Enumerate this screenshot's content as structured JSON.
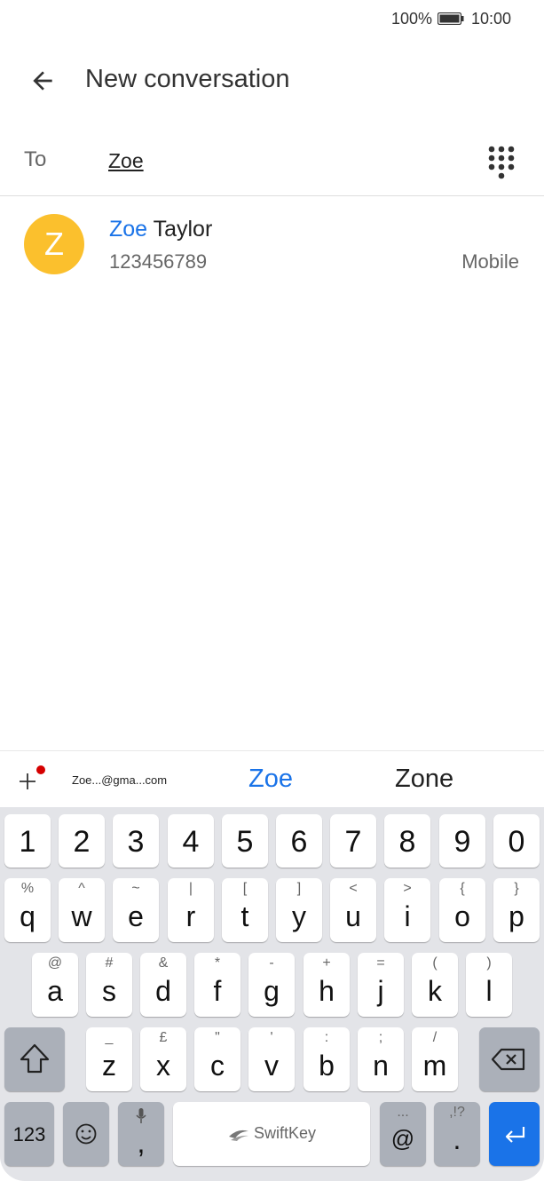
{
  "status_bar": {
    "battery": "100%",
    "time": "10:00"
  },
  "app_bar": {
    "title": "New conversation"
  },
  "recipient": {
    "label": "To",
    "value": "Zoe"
  },
  "contact": {
    "avatar_letter": "Z",
    "avatar_color": "#fbc02d",
    "name_match": "Zoe",
    "name_rest": " Taylor",
    "number": "123456789",
    "type": "Mobile"
  },
  "suggestions": {
    "email": "Zoe...@gma...com",
    "items": [
      "Zoe",
      "Zone"
    ]
  },
  "keyboard": {
    "number_row": [
      "1",
      "2",
      "3",
      "4",
      "5",
      "6",
      "7",
      "8",
      "9",
      "0"
    ],
    "row1": [
      {
        "main": "q",
        "sub": "%"
      },
      {
        "main": "w",
        "sub": "^"
      },
      {
        "main": "e",
        "sub": "~"
      },
      {
        "main": "r",
        "sub": "|"
      },
      {
        "main": "t",
        "sub": "["
      },
      {
        "main": "y",
        "sub": "]"
      },
      {
        "main": "u",
        "sub": "<"
      },
      {
        "main": "i",
        "sub": ">"
      },
      {
        "main": "o",
        "sub": "{"
      },
      {
        "main": "p",
        "sub": "}"
      }
    ],
    "row2": [
      {
        "main": "a",
        "sub": "@"
      },
      {
        "main": "s",
        "sub": "#"
      },
      {
        "main": "d",
        "sub": "&"
      },
      {
        "main": "f",
        "sub": "*"
      },
      {
        "main": "g",
        "sub": "-"
      },
      {
        "main": "h",
        "sub": "+"
      },
      {
        "main": "j",
        "sub": "="
      },
      {
        "main": "k",
        "sub": "("
      },
      {
        "main": "l",
        "sub": ")"
      }
    ],
    "row3": [
      {
        "main": "z",
        "sub": "_"
      },
      {
        "main": "x",
        "sub": "£"
      },
      {
        "main": "c",
        "sub": "\""
      },
      {
        "main": "v",
        "sub": "'"
      },
      {
        "main": "b",
        "sub": ":"
      },
      {
        "main": "n",
        "sub": ";"
      },
      {
        "main": "m",
        "sub": "/"
      }
    ],
    "numbers_key": "123",
    "comma_key": ",",
    "space_label": "SwiftKey",
    "at_key": {
      "main": "@",
      "sub": "..."
    },
    "period_key": {
      "main": ".",
      "sub": ",!?"
    },
    "accent_color": "#1a73e8"
  }
}
